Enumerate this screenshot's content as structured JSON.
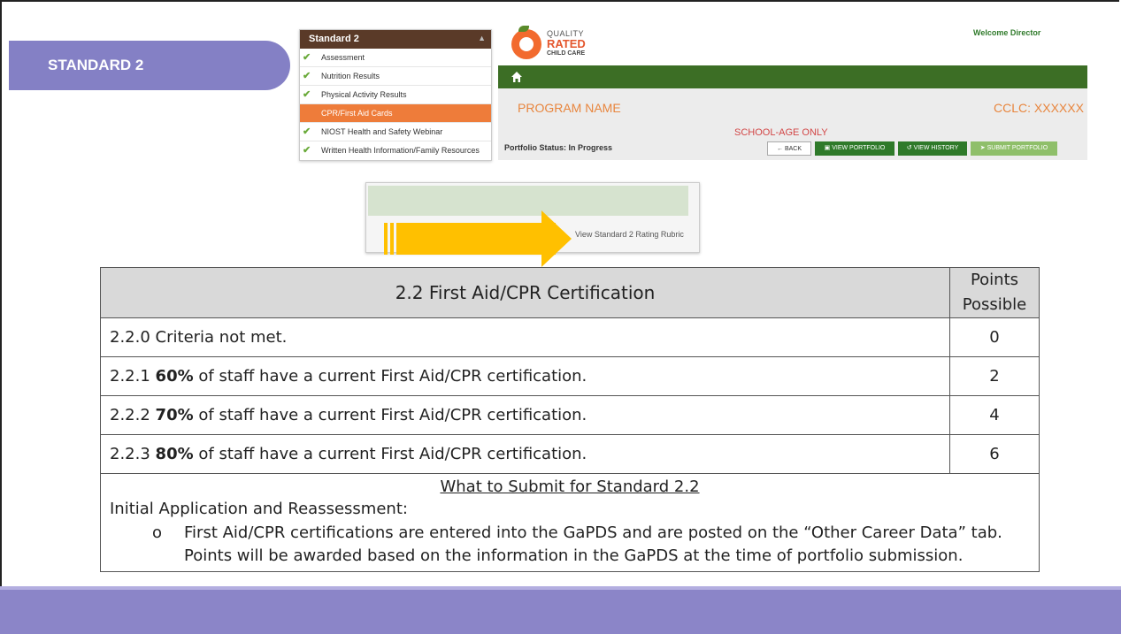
{
  "section_tab": "STANDARD 2",
  "menu": {
    "title": "Standard 2",
    "items": [
      {
        "label": "Assessment",
        "checked": true,
        "active": false
      },
      {
        "label": "Nutrition Results",
        "checked": true,
        "active": false
      },
      {
        "label": "Physical Activity Results",
        "checked": true,
        "active": false
      },
      {
        "label": "CPR/First Aid Cards",
        "checked": false,
        "active": true
      },
      {
        "label": "NIOST Health and Safety Webinar",
        "checked": true,
        "active": false
      },
      {
        "label": "Written Health Information/Family Resources",
        "checked": true,
        "active": false
      }
    ]
  },
  "header": {
    "logo_line1": "QUALITY",
    "logo_line2": "RATED",
    "logo_line3": "CHILD CARE",
    "welcome": "Welcome Director",
    "program_name": "PROGRAM NAME",
    "cclc": "CCLC: XXXXXX",
    "school_age": "SCHOOL-AGE ONLY",
    "portfolio_status": "Portfolio Status: In Progress",
    "buttons": {
      "back": "BACK",
      "view_portfolio": "VIEW PORTFOLIO",
      "view_history": "VIEW HISTORY",
      "submit_portfolio": "SUBMIT PORTFOLIO"
    }
  },
  "rubric_link": "View Standard 2 Rating Rubric",
  "table": {
    "title": "2.2  First Aid/CPR Certification",
    "points_header": "Points Possible",
    "rows": [
      {
        "code": "2.2.0",
        "bold": "",
        "text": "Criteria not met.",
        "points": "0"
      },
      {
        "code": "2.2.1",
        "bold": "60%",
        "text": "of staff have a current First Aid/CPR certification.",
        "points": "2"
      },
      {
        "code": "2.2.2",
        "bold": "70%",
        "text": "of staff have a current First Aid/CPR certification.",
        "points": "4"
      },
      {
        "code": "2.2.3",
        "bold": "80%",
        "text": "of staff have a current First Aid/CPR certification.",
        "points": "6"
      }
    ],
    "submit_title": "What to Submit for Standard 2.2",
    "submit_line1": "Initial Application and Reassessment:",
    "bullet_char": "o",
    "bullet_line1": "First Aid/CPR certifications are entered into the GaPDS and are posted on the “Other Career Data” tab.",
    "bullet_line2": "Points will be awarded based on the information in the GaPDS at the time of portfolio submission."
  },
  "colors": {
    "tab_purple": "#8480c5",
    "green_bar": "#3c6e25",
    "active_orange": "#ee7c3a",
    "program_orange": "#e8853d",
    "arrow_yellow": "#ffc000"
  }
}
